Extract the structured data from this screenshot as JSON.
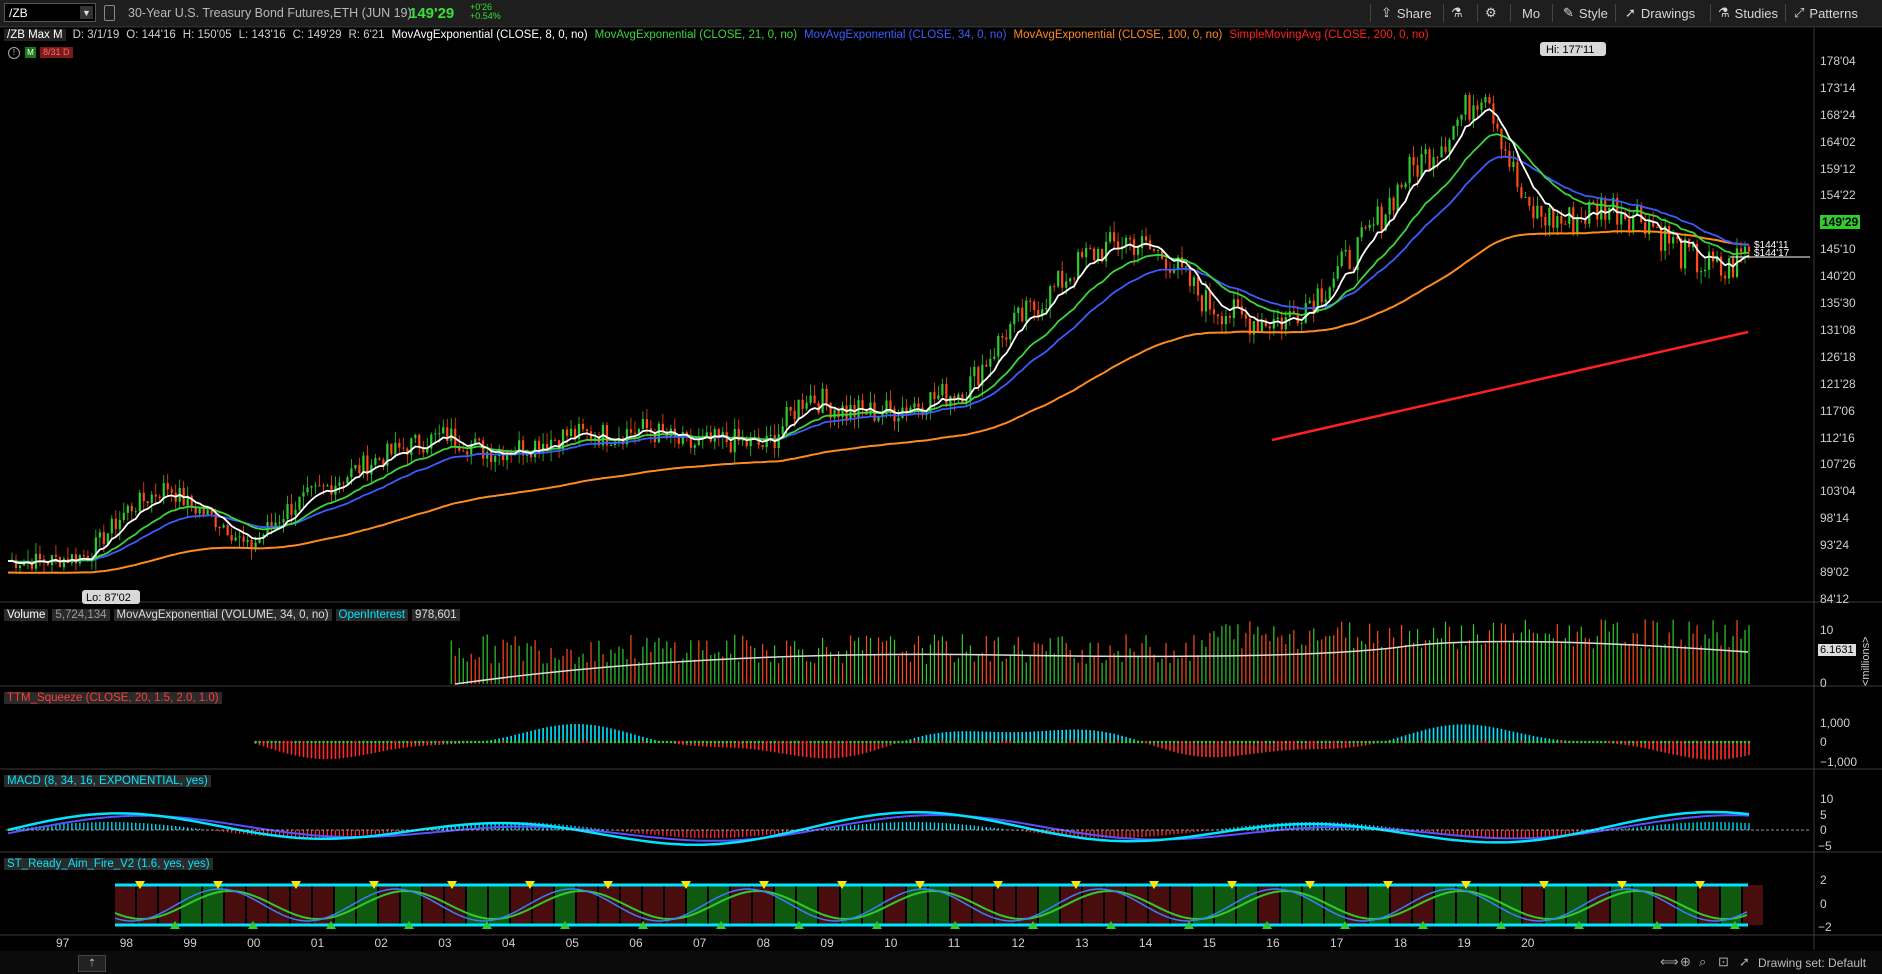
{
  "toolbar": {
    "symbol": "/ZB",
    "description": "30-Year U.S. Treasury Bond Futures,ETH (JUN 19)",
    "last": "149'29",
    "change": "+0'26",
    "change_pct": "+0.54%",
    "share_label": "Share",
    "interval_label": "Mo",
    "style_label": "Style",
    "drawings_label": "Drawings",
    "studies_label": "Studies",
    "patterns_label": "Patterns"
  },
  "info": {
    "chart_name": "/ZB Max M",
    "date": "D: 3/1/19",
    "open": "O: 144'16",
    "high": "H: 150'05",
    "low": "L: 143'16",
    "close": "C: 149'29",
    "range": "R: 6'21",
    "studies": [
      {
        "label": "MovAvgExponential (CLOSE, 8, 0, no)",
        "color": "#ffffff"
      },
      {
        "label": "MovAvgExponential (CLOSE, 21, 0, no)",
        "color": "#3bd63b"
      },
      {
        "label": "MovAvgExponential (CLOSE, 34, 0, no)",
        "color": "#3c5cff"
      },
      {
        "label": "MovAvgExponential (CLOSE, 100, 0, no)",
        "color": "#ff8a1e"
      },
      {
        "label": "SimpleMovingAvg (CLOSE, 200, 0, no)",
        "color": "#ff2020"
      }
    ],
    "alert_badge": "8/31 D",
    "pause_icon": "pause-icon",
    "m_icon": "M"
  },
  "price_axis": {
    "labels": [
      "178'04",
      "173'14",
      "168'24",
      "164'02",
      "159'12",
      "154'22",
      "149'29",
      "145'10",
      "140'20",
      "135'30",
      "131'08",
      "126'18",
      "121'28",
      "117'06",
      "112'16",
      "107'26",
      "103'04",
      "98'14",
      "93'24",
      "89'02",
      "84'12"
    ],
    "last_badge": "149'29",
    "extra_badge_1": "$144'11",
    "extra_badge_2": "$144'17",
    "hi_label": "Hi: 177'11",
    "lo_label": "Lo: 87'02"
  },
  "volume_panel": {
    "label": "Volume",
    "value": "5,724,134",
    "study": "MovAvgExponential (VOLUME, 34, 0, no)",
    "oi_label": "OpenInterest",
    "oi_value": "978,601",
    "axis_top": "10",
    "axis_bottom": "0",
    "badge": "6.1631",
    "unit": "<millions>"
  },
  "squeeze_panel": {
    "label": "TTM_Squeeze (CLOSE, 20, 1.5, 2.0, 1.0)",
    "axis": [
      "1,000",
      "0",
      "−1,000"
    ]
  },
  "macd_panel": {
    "label": "MACD (8, 34, 16, EXPONENTIAL, yes)",
    "axis": [
      "10",
      "5",
      "0",
      "−5"
    ]
  },
  "raf_panel": {
    "label": "ST_Ready_Aim_Fire_V2 (1.6, yes, yes)",
    "axis": [
      "2",
      "0",
      "−2"
    ]
  },
  "time_axis": {
    "labels": [
      "97",
      "98",
      "99",
      "00",
      "01",
      "02",
      "03",
      "04",
      "05",
      "06",
      "07",
      "08",
      "09",
      "10",
      "11",
      "12",
      "13",
      "14",
      "15",
      "16",
      "17",
      "18",
      "19",
      "20"
    ]
  },
  "footer": {
    "drawing_set": "Drawing set: Default"
  },
  "colors": {
    "up": "#2ecc2e",
    "down": "#ff4a1a",
    "ema8": "#ffffff",
    "ema21": "#3bd63b",
    "ema34": "#3c5cff",
    "ema100": "#ff8a1e",
    "sma200": "#ff2020",
    "cyan": "#00e5ff"
  }
}
